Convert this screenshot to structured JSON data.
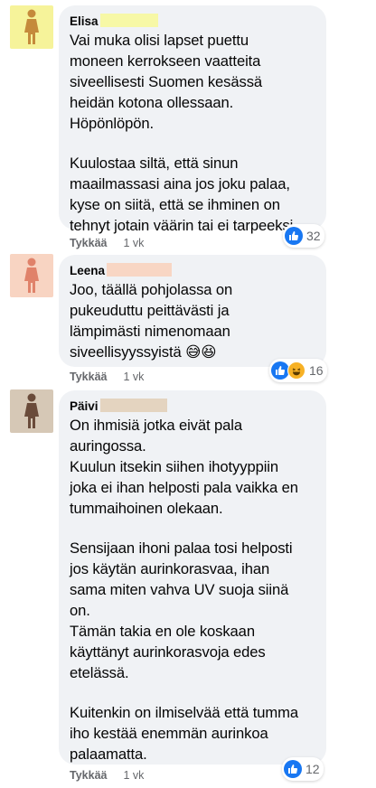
{
  "comments": [
    {
      "author": "Elisa",
      "avatar_color": "#f6f39a",
      "figure_color": "#c58a3b",
      "redaction_color": "#f7f8a6",
      "paragraphs": [
        "Vai muka olisi lapset puettu\nmoneen kerrokseen vaatteita\nsiveellisesti Suomen kesässä\nheidän kotona ollessaan.\nHöpönlöpön.",
        "Kuulostaa siltä, että sinun\nmaailmassasi aina jos joku palaa,\nkyse on siitä, että se ihminen on\ntehnyt jotain väärin tai ei tarpeeksi."
      ],
      "like_label": "Tykkää",
      "time": "1 vk",
      "reaction_count": "32",
      "reactions": [
        "like-icon"
      ]
    },
    {
      "author": "Leena",
      "avatar_color": "#f8d4c2",
      "figure_color": "#e0826a",
      "redaction_color": "#f8d6c4",
      "paragraphs": [
        "Joo, täällä pohjolassa on\npukeuduttu peittävästi ja\nlämpimästi nimenomaan\nsiveellisyyssyistä 😅😆"
      ],
      "like_label": "Tykkää",
      "time": "1 vk",
      "reaction_count": "16",
      "reactions": [
        "like-icon",
        "haha-icon"
      ]
    },
    {
      "author": "Päivi",
      "avatar_color": "#d6c8b6",
      "figure_color": "#6a4b3a",
      "redaction_color": "#e4d4c0",
      "paragraphs": [
        "On ihmisiä jotka eivät pala\nauringossa.\nKuulun itsekin siihen ihotyyppiin\njoka ei ihan helposti pala vaikka en\ntummaihoinen olekaan.",
        "Sensijaan ihoni palaa tosi helposti\njos käytän aurinkorasvaa, ihan\nsama miten vahva UV suoja siinä\non.\nTämän takia en ole koskaan\nkäyttänyt aurinkorasvoja edes\netelässä.",
        "Kuitenkin on ilmiselvää että tumma\niho kestää enemmän aurinkoa\npalaamatta."
      ],
      "like_label": "Tykkää",
      "time": "1 vk",
      "reaction_count": "12",
      "reactions": [
        "like-icon"
      ]
    }
  ],
  "colors": {
    "bubble": "#f0f2f5",
    "like_blue": "#1877f2",
    "meta_gray": "#65676b"
  }
}
